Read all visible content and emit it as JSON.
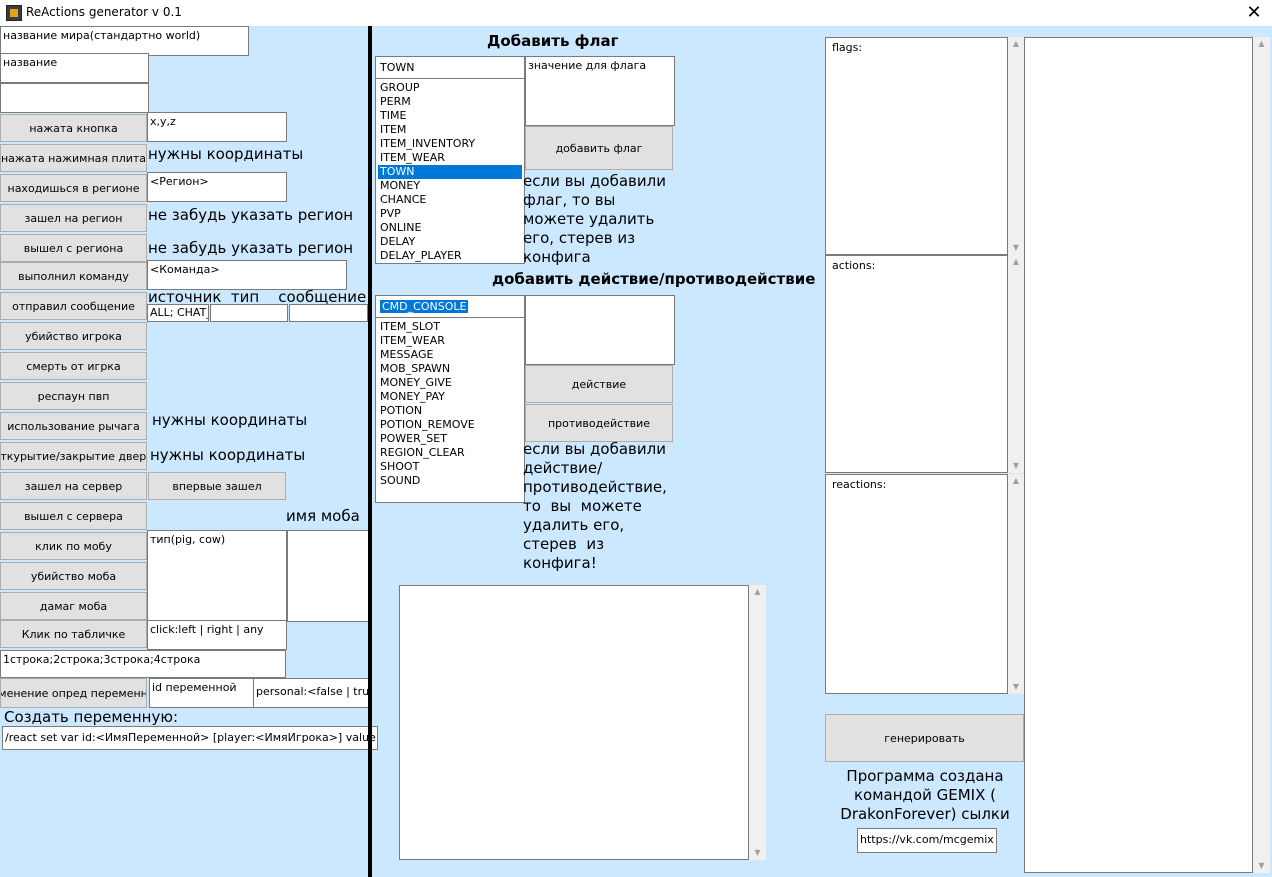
{
  "window": {
    "title": "ReActions generator v 0.1"
  },
  "left": {
    "world_name": "название мира(стандартно world)",
    "name": "название",
    "blank_field": "",
    "buttons": [
      "нажата кнопка",
      "нажата нажимная плита",
      "находишься в регионе",
      "зашел на регион",
      "вышел с региона",
      "выполнил команду",
      "отправил сообщение",
      "убийство игрока",
      "смерть от игрка",
      "респаун пвп",
      "использование рычага",
      "откурытие/закрытие двери",
      "зашел на сервер",
      "вышел с сервера",
      "клик по мобу",
      "убийство моба",
      "дамаг моба",
      "Клик по табличке",
      "изменение опред переменной"
    ],
    "xyz_field": "x,y,z",
    "coords_hint_1": "нужны координаты",
    "region_field": "<Регион>",
    "region_hint_1": "не забудь указать регион",
    "region_hint_2": "не забудь указать регион",
    "command_field": "<Команда>",
    "message_labels": "источник  тип    сообщение",
    "message_source": "ALL; CHAT_",
    "message_type": "",
    "message_text": "",
    "coords_hint_2": "нужны координаты",
    "coords_hint_3": "нужны координаты",
    "first_join_button": "впервые зашел",
    "mob_name_label": "имя моба",
    "mob_type_field": "тип(pig, cow)",
    "mob_name_field": "",
    "sign_click_field": "click:left | right | any",
    "sign_lines_field": "1строка;2строка;3строка;4строка",
    "var_id_field": "id переменной",
    "var_personal_field": "personal:<false | true>",
    "create_var_label": "Создать переменную:",
    "create_var_cmd": "/react set var id:<ИмяПеременной> [player:<ИмяИгрока>] value:<Значение"
  },
  "middle": {
    "flag_header": "Добавить флаг",
    "flag_combo": "TOWN",
    "flag_items": [
      "GROUP",
      "PERM",
      "TIME",
      "ITEM",
      "ITEM_INVENTORY",
      "ITEM_WEAR",
      "TOWN",
      "MONEY",
      "CHANCE",
      "PVP",
      "ONLINE",
      "DELAY",
      "DELAY_PLAYER"
    ],
    "flag_selected": "TOWN",
    "flag_value": "значение для флага",
    "add_flag_button": "добавить флаг",
    "flag_hint_lines": [
      "если вы добавили",
      "флаг, то вы",
      "можете удалить",
      "его, стерев из",
      "конфига"
    ],
    "action_header": "добавить действие/противодействие",
    "action_combo": "CMD_CONSOLE",
    "action_items": [
      "ITEM_SLOT",
      "ITEM_WEAR",
      "MESSAGE",
      "MOB_SPAWN",
      "MONEY_GIVE",
      "MONEY_PAY",
      "POTION",
      "POTION_REMOVE",
      "POWER_SET",
      "REGION_CLEAR",
      "SHOOT",
      "SOUND"
    ],
    "action_value": "",
    "action_button": "действие",
    "reaction_button": "противодействие",
    "action_hint_lines": [
      "если вы добавили",
      "действие/",
      "противодействие,",
      "то  вы  можете",
      "удалить его,",
      "стерев  из",
      "конфига!"
    ],
    "output_text": ""
  },
  "right": {
    "flags_label": "flags:",
    "actions_label": "actions:",
    "reactions_label": "reactions:",
    "generate_button": "генерировать",
    "credits_lines": [
      "Программа создана",
      "командой GEMIX (",
      "DrakonForever) сылки"
    ],
    "link_field": "https://vk.com/mcgemix",
    "result_text": ""
  }
}
